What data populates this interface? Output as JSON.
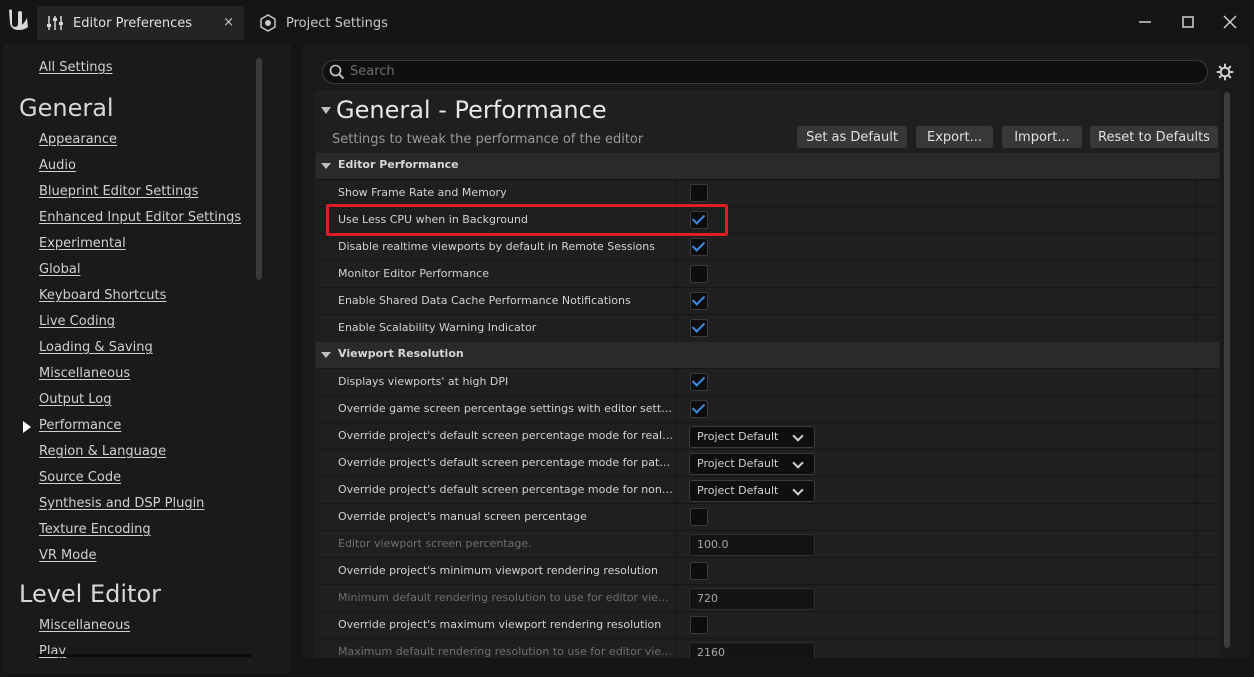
{
  "tabs": [
    {
      "label": "Editor Preferences",
      "active": true,
      "icon": "settings-sliders-icon"
    },
    {
      "label": "Project Settings",
      "active": false,
      "icon": "project-settings-icon"
    }
  ],
  "close_glyph": "×",
  "search": {
    "placeholder": "Search"
  },
  "sidebar": {
    "all_settings": "All Settings",
    "general_heading": "General",
    "general_items": [
      "Appearance",
      "Audio",
      "Blueprint Editor Settings",
      "Enhanced Input Editor Settings",
      "Experimental",
      "Global",
      "Keyboard Shortcuts",
      "Live Coding",
      "Loading & Saving",
      "Miscellaneous",
      "Output Log",
      "Performance",
      "Region & Language",
      "Source Code",
      "Synthesis and DSP Plugin",
      "Texture Encoding",
      "VR Mode"
    ],
    "selected": "Performance",
    "level_editor_heading": "Level Editor",
    "level_editor_items": [
      "Miscellaneous",
      "Play"
    ]
  },
  "section": {
    "title": "General - Performance",
    "description": "Settings to tweak the performance of the editor",
    "buttons": [
      "Set as Default",
      "Export...",
      "Import...",
      "Reset to Defaults"
    ]
  },
  "categories": {
    "editor_performance": {
      "label": "Editor Performance",
      "rows": [
        {
          "name": "Show Frame Rate and Memory",
          "type": "checkbox",
          "checked": false
        },
        {
          "name": "Use Less CPU when in Background",
          "type": "checkbox",
          "checked": true
        },
        {
          "name": "Disable realtime viewports by default in Remote Sessions",
          "type": "checkbox",
          "checked": true
        },
        {
          "name": "Monitor Editor Performance",
          "type": "checkbox",
          "checked": false
        },
        {
          "name": "Enable Shared Data Cache Performance Notifications",
          "type": "checkbox",
          "checked": true
        },
        {
          "name": "Enable Scalability Warning Indicator",
          "type": "checkbox",
          "checked": true
        }
      ]
    },
    "viewport_resolution": {
      "label": "Viewport Resolution",
      "rows": [
        {
          "name": "Displays viewports' at high DPI",
          "type": "checkbox",
          "checked": true
        },
        {
          "name": "Override game screen percentage settings with editor settings in PIE",
          "type": "checkbox",
          "checked": true
        },
        {
          "name": "Override project's default screen percentage mode for realtime editor viewports",
          "type": "dropdown",
          "value": "Project Default"
        },
        {
          "name": "Override project's default screen percentage mode for path-traced viewports",
          "type": "dropdown",
          "value": "Project Default"
        },
        {
          "name": "Override project's default screen percentage mode for non-realtime viewports",
          "type": "dropdown",
          "value": "Project Default"
        },
        {
          "name": "Override project's manual screen percentage",
          "type": "checkbox",
          "checked": false
        },
        {
          "name": "Editor viewport screen percentage.",
          "type": "number",
          "value": "100.0",
          "disabled": true
        },
        {
          "name": "Override project's minimum viewport rendering resolution",
          "type": "checkbox",
          "checked": false
        },
        {
          "name": "Minimum default rendering resolution to use for editor viewports.",
          "type": "number",
          "value": "720",
          "disabled": true
        },
        {
          "name": "Override project's maximum viewport rendering resolution",
          "type": "checkbox",
          "checked": false
        },
        {
          "name": "Maximum default rendering resolution to use for editor viewports.",
          "type": "number",
          "value": "2160",
          "disabled": true
        }
      ]
    }
  },
  "colors": {
    "accent_check": "#3d8be8",
    "highlight_box": "#e01d25"
  }
}
